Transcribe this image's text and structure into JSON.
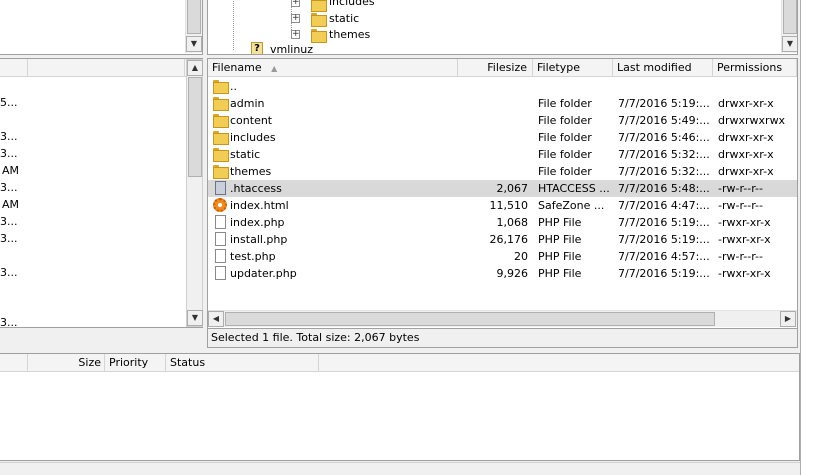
{
  "remote_tree": {
    "items": [
      {
        "label": "includes"
      },
      {
        "label": "static"
      },
      {
        "label": "themes"
      },
      {
        "label": "vmlinuz"
      }
    ]
  },
  "local_list": {
    "rows": [
      "5...",
      "3...",
      "3...",
      "AM",
      "3...",
      "AM",
      "3...",
      "3...",
      "3...",
      "3..."
    ]
  },
  "remote_list": {
    "columns": {
      "filename": "Filename",
      "filesize": "Filesize",
      "filetype": "Filetype",
      "modified": "Last modified",
      "permissions": "Permissions"
    },
    "rows": [
      {
        "name": "..",
        "size": "",
        "type": "",
        "modified": "",
        "perms": "",
        "icon": "folder-icon"
      },
      {
        "name": "admin",
        "size": "",
        "type": "File folder",
        "modified": "7/7/2016 5:19:...",
        "perms": "drwxr-xr-x",
        "icon": "folder-icon"
      },
      {
        "name": "content",
        "size": "",
        "type": "File folder",
        "modified": "7/7/2016 5:49:...",
        "perms": "drwxrwxrwx",
        "icon": "folder-icon"
      },
      {
        "name": "includes",
        "size": "",
        "type": "File folder",
        "modified": "7/7/2016 5:46:...",
        "perms": "drwxr-xr-x",
        "icon": "folder-icon"
      },
      {
        "name": "static",
        "size": "",
        "type": "File folder",
        "modified": "7/7/2016 5:32:...",
        "perms": "drwxr-xr-x",
        "icon": "folder-icon"
      },
      {
        "name": "themes",
        "size": "",
        "type": "File folder",
        "modified": "7/7/2016 5:32:...",
        "perms": "drwxr-xr-x",
        "icon": "folder-icon"
      },
      {
        "name": ".htaccess",
        "size": "2,067",
        "type": "HTACCESS ...",
        "modified": "7/7/2016 5:48:...",
        "perms": "-rw-r--r--",
        "icon": "htaccess-file-icon",
        "selected": true
      },
      {
        "name": "index.html",
        "size": "11,510",
        "type": "SafeZone ...",
        "modified": "7/7/2016 4:47:...",
        "perms": "-rw-r--r--",
        "icon": "html-file-icon"
      },
      {
        "name": "index.php",
        "size": "1,068",
        "type": "PHP File",
        "modified": "7/7/2016 5:19:...",
        "perms": "-rwxr-xr-x",
        "icon": "file-icon"
      },
      {
        "name": "install.php",
        "size": "26,176",
        "type": "PHP File",
        "modified": "7/7/2016 5:19:...",
        "perms": "-rwxr-xr-x",
        "icon": "file-icon"
      },
      {
        "name": "test.php",
        "size": "20",
        "type": "PHP File",
        "modified": "7/7/2016 4:57:...",
        "perms": "-rw-r--r--",
        "icon": "file-icon"
      },
      {
        "name": "updater.php",
        "size": "9,926",
        "type": "PHP File",
        "modified": "7/7/2016 5:19:...",
        "perms": "-rwxr-xr-x",
        "icon": "file-icon"
      }
    ]
  },
  "status_bar": {
    "text": "Selected 1 file. Total size: 2,067 bytes"
  },
  "queue": {
    "columns": {
      "size": "Size",
      "priority": "Priority",
      "status": "Status"
    }
  },
  "colors": {
    "selection": "#d9d9d9",
    "folder": "#f2cd56",
    "html_icon": "#f08a24"
  }
}
